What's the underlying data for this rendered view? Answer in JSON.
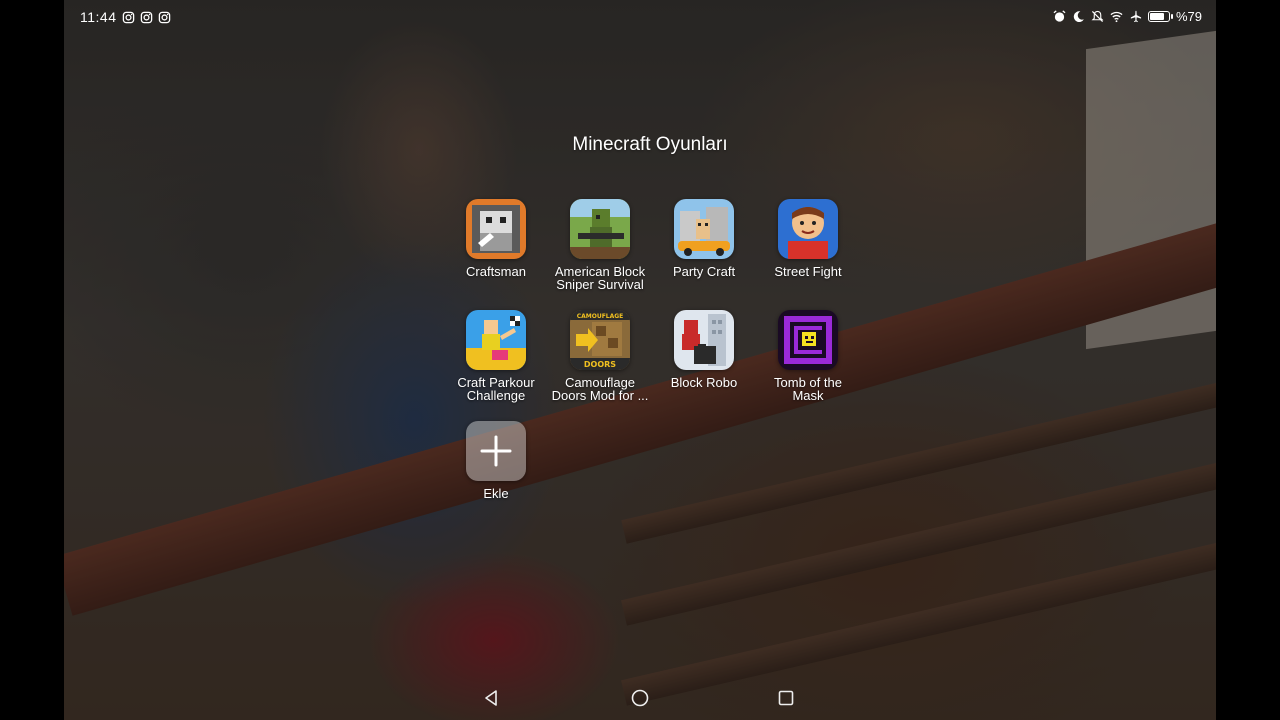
{
  "status_bar": {
    "time": "11:44",
    "notification_icons": [
      "instagram-icon",
      "instagram-icon",
      "instagram-icon"
    ],
    "right_icons": [
      "alarm-icon",
      "do-not-disturb-moon-icon",
      "notifications-muted-icon",
      "wifi-icon",
      "airplane-mode-icon",
      "battery-icon"
    ],
    "battery_percent": "%79",
    "battery_level": 0.79
  },
  "folder": {
    "title": "Minecraft Oyunları",
    "apps": [
      {
        "label_lines": [
          "Craftsman",
          ""
        ],
        "icon": "craftsman-app-icon"
      },
      {
        "label_lines": [
          "American Block",
          "Sniper Survival"
        ],
        "icon": "american-block-sniper-app-icon"
      },
      {
        "label_lines": [
          "Party Craft",
          ""
        ],
        "icon": "party-craft-app-icon"
      },
      {
        "label_lines": [
          "Street Fight",
          ""
        ],
        "icon": "street-fight-app-icon"
      },
      {
        "label_lines": [
          "Craft Parkour",
          "Challenge"
        ],
        "icon": "craft-parkour-app-icon"
      },
      {
        "label_lines": [
          "Camouflage",
          "Doors Mod for ..."
        ],
        "icon": "camouflage-doors-app-icon",
        "icon_text": [
          "CAMOUFLAGE",
          "DOORS"
        ]
      },
      {
        "label_lines": [
          "Block Robo",
          ""
        ],
        "icon": "block-robo-app-icon"
      },
      {
        "label_lines": [
          "Tomb of the",
          "Mask"
        ],
        "icon": "tomb-of-the-mask-app-icon"
      },
      {
        "label_lines": [
          "Ekle",
          ""
        ],
        "icon": "add-plus-icon"
      }
    ]
  },
  "nav_bar": {
    "buttons": [
      "back-triangle-icon",
      "home-circle-icon",
      "recents-square-icon"
    ]
  }
}
